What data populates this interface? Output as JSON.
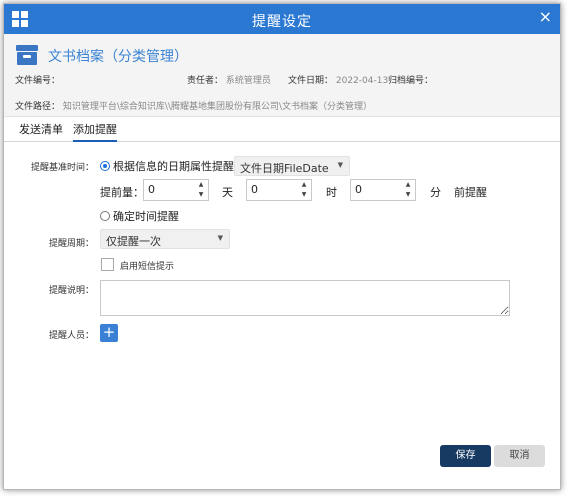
{
  "dialog": {
    "title": "提醒设定",
    "close_glyph": "×",
    "title_bar_color": "#2b78d3"
  },
  "document": {
    "title": "文书档案（分类管理）",
    "file_no_label": "文件编号：",
    "owner_label": "责任者：",
    "owner_value": "系统管理员",
    "file_date_label": "文件日期：",
    "file_date_value": "2022-04-13",
    "archive_no_label": "归档编号：",
    "path_label": "文件路径：",
    "path_value": "知识管理平台\\综合知识库\\\\腾耀基地集团股份有限公司\\文书档案（分类管理）"
  },
  "tabs": [
    {
      "label": "发送清单",
      "active": false
    },
    {
      "label": "添加提醒",
      "active": true
    }
  ],
  "form": {
    "base_time_label": "提醒基准时间：",
    "option_date_attr": "根据信息的日期属性提醒：",
    "date_attr_select": "文件日期FileDate",
    "advance_label": "提前量：",
    "days_value": "0",
    "days_unit": "天",
    "hours_value": "0",
    "hours_unit": "时",
    "minutes_value": "0",
    "minutes_unit": "分",
    "before_remind": "前提醒",
    "option_fixed_time": "确定时间提醒",
    "period_label": "提醒周期：",
    "period_select": "仅提醒一次",
    "sms_label": "启用短信提示",
    "desc_label": "提醒说明：",
    "desc_value": "",
    "persons_label": "提醒人员：",
    "add_person_glyph": "+"
  },
  "buttons": {
    "save": "保存",
    "cancel": "取消"
  },
  "colors": {
    "accent": "#2b78d3",
    "save_button": "#173a63",
    "cancel_button": "#dcdcdc"
  }
}
